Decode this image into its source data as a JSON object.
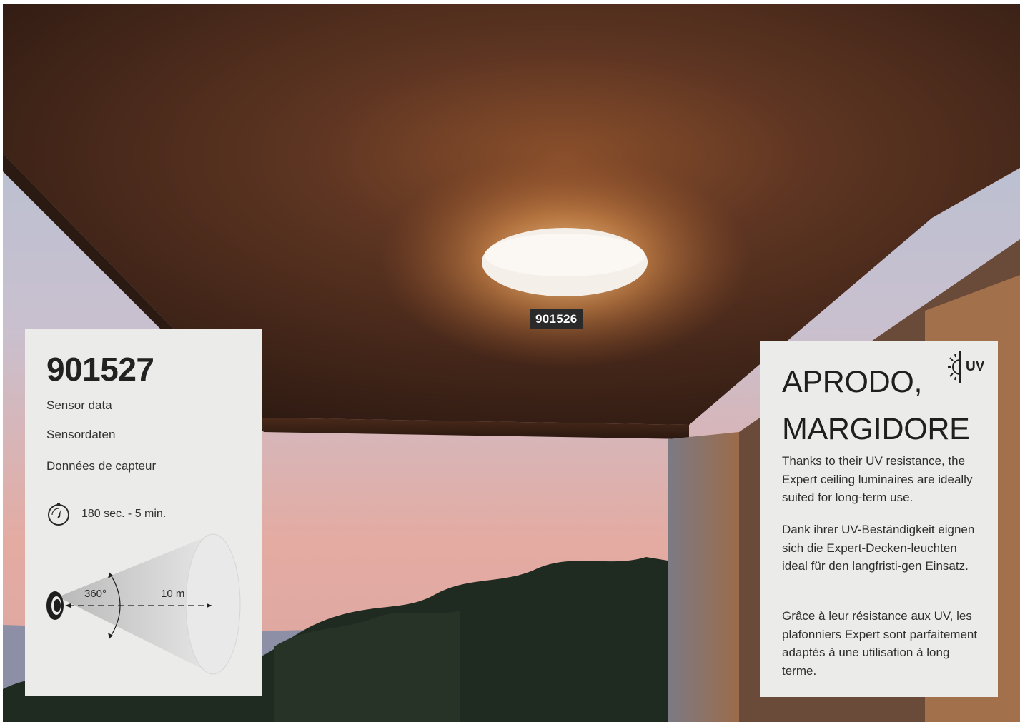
{
  "photo": {
    "scene": "ceiling-light-terrace-photo",
    "colors": {
      "ceiling": "#5a3624",
      "sky_top": "#b7c3d3",
      "sky_bottom": "#e2a9a1",
      "glow": "#f3b46b"
    }
  },
  "lamp_label": "901526",
  "sensor_card": {
    "model": "901527",
    "lines": [
      "Sensor data",
      "Sensordaten",
      "Données de capteur"
    ],
    "timer": "180 sec. - 5 min.",
    "angle": "360°",
    "range": "10 m",
    "icons": {
      "timer": "stopwatch-icon",
      "sensor": "motion-sensor-icon"
    }
  },
  "info_card": {
    "title_line1": "APRODO,",
    "title_line2": "MARGIDORE",
    "uv_label": "UV",
    "uv_icon": "uv-sun-icon",
    "paragraphs": [
      "Thanks to their UV resistance, the Expert ceiling luminaires are ideally suited for long-term use.",
      "Dank ihrer UV-Beständigkeit eignen sich die Expert-Decken-leuchten ideal für den langfristi-gen Einsatz.",
      "Grâce à leur résistance aux UV, les plafonniers Expert sont parfaitement adaptés à une utilisation à long terme."
    ]
  }
}
